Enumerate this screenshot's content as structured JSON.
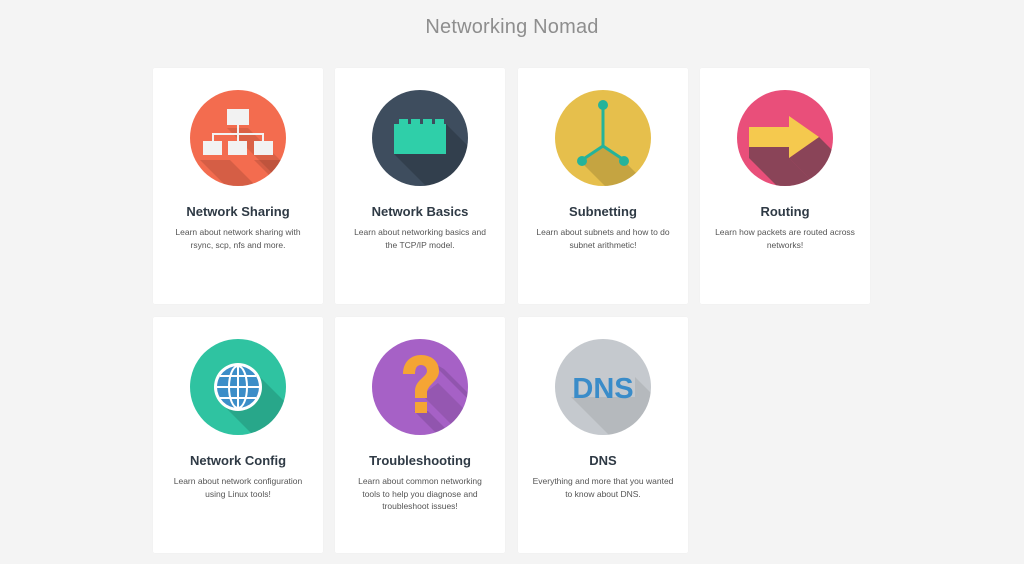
{
  "site": {
    "title": "Networking Nomad"
  },
  "colors": {
    "background": "#f4f4f4",
    "card": "#ffffff",
    "network_sharing": "#f36c4f",
    "network_basics": "#3e4d5e",
    "subnetting": "#e6bf4c",
    "routing": "#e94f7a",
    "network_config": "#2fc3a1",
    "troubleshooting": "#a661c6",
    "dns": "#c5c9ce"
  },
  "cards": [
    {
      "title": "Network Sharing",
      "description": "Learn about network sharing with rsync, scp, nfs and more.",
      "icon": "network-hierarchy-icon"
    },
    {
      "title": "Network Basics",
      "description": "Learn about networking basics and the TCP/IP model.",
      "icon": "network-card-icon"
    },
    {
      "title": "Subnetting",
      "description": "Learn about subnets and how to do subnet arithmetic!",
      "icon": "subnet-branch-icon"
    },
    {
      "title": "Routing",
      "description": "Learn how packets are routed across networks!",
      "icon": "arrow-right-icon"
    },
    {
      "title": "Network Config",
      "description": "Learn about network configuration using Linux tools!",
      "icon": "globe-icon"
    },
    {
      "title": "Troubleshooting",
      "description": "Learn about common networking tools to help you diagnose and troubleshoot issues!",
      "icon": "question-mark-icon"
    },
    {
      "title": "DNS",
      "description": "Everything and more that you wanted to know about DNS.",
      "icon": "dns-icon",
      "icon_text": "DNS"
    }
  ]
}
